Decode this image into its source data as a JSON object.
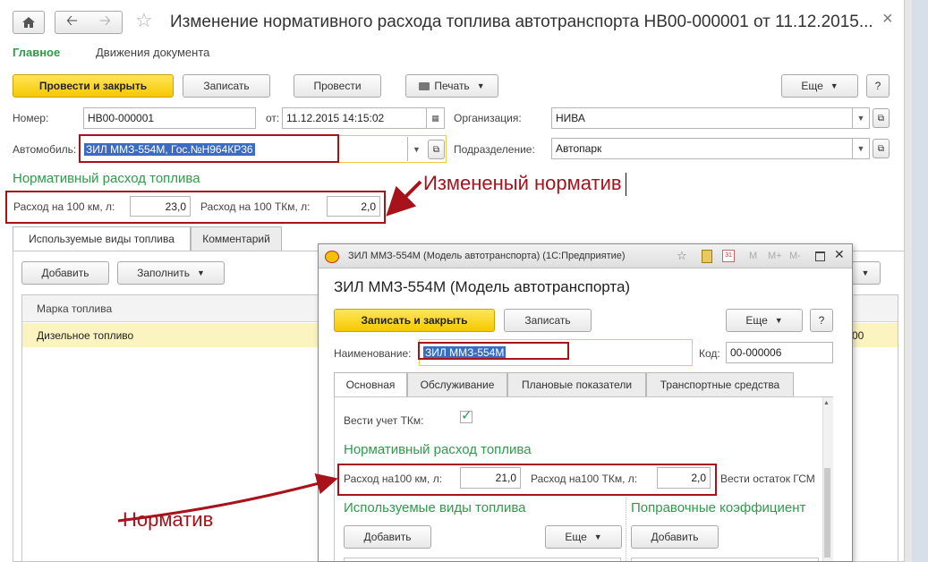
{
  "window": {
    "title": "Изменение нормативного расхода топлива автотранспорта НВ00-000001 от 11.12.2015...",
    "close": "×"
  },
  "nav": {
    "main": "Главное",
    "movements": "Движения документа"
  },
  "toolbar": {
    "post_close": "Провести и закрыть",
    "save": "Записать",
    "post": "Провести",
    "print": "Печать",
    "more": "Еще",
    "help": "?"
  },
  "form": {
    "number_label": "Номер:",
    "number_value": "НВ00-000001",
    "date_label": "от:",
    "date_value": "11.12.2015 14:15:02",
    "org_label": "Организация:",
    "org_value": "НИВА",
    "vehicle_label": "Автомобиль:",
    "vehicle_value": "ЗИЛ ММЗ-554М, Гос.№Н964КР36",
    "division_label": "Подразделение:",
    "division_value": "Автопарк"
  },
  "norm": {
    "header": "Нормативный расход топлива",
    "per100km_label": "Расход на 100 км, л:",
    "per100km_value": "23,0",
    "per100tkm_label": "Расход на 100 ТКм, л:",
    "per100tkm_value": "2,0"
  },
  "tabs": [
    "Используемые виды топлива",
    "Комментарий"
  ],
  "fuel_toolbar": {
    "add": "Добавить",
    "fill": "Заполнить"
  },
  "fuel_table": {
    "header": "Марка топлива",
    "rows": [
      "Дизельное топливо"
    ],
    "right_fragment": "00"
  },
  "annotations": {
    "changed": "Измененый норматив",
    "norm": "Норматив"
  },
  "popup": {
    "title": "ЗИЛ ММЗ-554М (Модель автотранспорта)  (1С:Предприятие)",
    "heading": "ЗИЛ ММЗ-554М (Модель автотранспорта)",
    "title_buttons": [
      "M",
      "M+",
      "M-"
    ],
    "save_close": "Записать и закрыть",
    "save": "Записать",
    "more": "Еще",
    "help": "?",
    "name_label": "Наименование:",
    "name_value": "ЗИЛ ММЗ-554М",
    "code_label": "Код:",
    "code_value": "00-000006",
    "tabs": [
      "Основная",
      "Обслуживание",
      "Плановые показатели",
      "Транспортные средства"
    ],
    "tkm_label": "Вести учет ТКм:",
    "norm_header": "Нормативный расход топлива",
    "per100km_label": "Расход на100 км, л:",
    "per100km_value": "21,0",
    "per100tkm_label": "Расход на100 ТКм, л:",
    "per100tkm_value": "2,0",
    "remain_label": "Вести остаток ГСМ",
    "fuel_types_header": "Используемые виды топлива",
    "corr_header": "Поправочные коэффициент",
    "add": "Добавить",
    "more2": "Еще",
    "add2": "Добавить"
  },
  "colors": {
    "accent_yellow": "#f5c800",
    "annotation_red": "#a8121a",
    "header_green": "#2e9b4b",
    "selection": "#3b6cc4"
  }
}
